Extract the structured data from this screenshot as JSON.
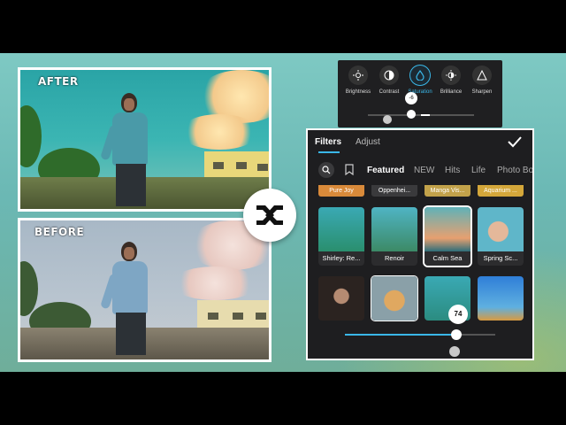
{
  "photos": {
    "after_label": "AFTER",
    "before_label": "BEFORE"
  },
  "adjust_toolbar": {
    "items": [
      {
        "label": "Brightness",
        "icon": "sun-icon",
        "active": false
      },
      {
        "label": "Contrast",
        "icon": "contrast-icon",
        "active": false
      },
      {
        "label": "Saturation",
        "icon": "drop-icon",
        "active": true
      },
      {
        "label": "Brilliance",
        "icon": "brilliance-icon",
        "active": false
      },
      {
        "label": "Sharpen",
        "icon": "triangle-icon",
        "active": false
      }
    ],
    "value": "-6"
  },
  "filters_panel": {
    "tabs": [
      {
        "label": "Filters",
        "active": true
      },
      {
        "label": "Adjust",
        "active": false
      }
    ],
    "categories": [
      "Featured",
      "NEW",
      "Hits",
      "Life",
      "Photo Bo"
    ],
    "active_category": "Featured",
    "partial_row": [
      "Pure Joy",
      "Oppenhei...",
      "Manga Vis...",
      "Aquarium ..."
    ],
    "filters": [
      {
        "label": "Shirley: Re...",
        "selected": false
      },
      {
        "label": "Renoir",
        "selected": false
      },
      {
        "label": "Calm Sea",
        "selected": true
      },
      {
        "label": "Spring Sc...",
        "selected": false
      }
    ],
    "intensity": "74",
    "accent_color": "#3ab7e8"
  }
}
